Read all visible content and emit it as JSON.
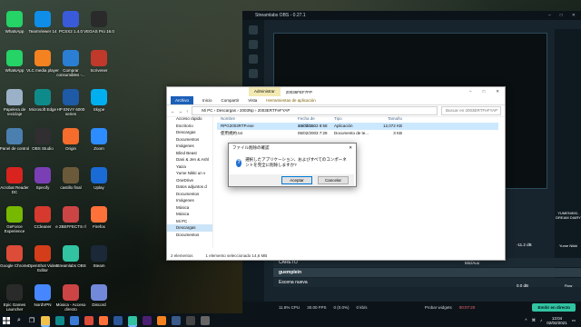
{
  "desktop_icons": [
    {
      "label": "WhatsApp",
      "color": "#25d366",
      "icon": "whatsapp-icon"
    },
    {
      "label": "TeamViewer 14",
      "color": "#0e8ee9",
      "icon": "teamviewer-icon"
    },
    {
      "label": "PCSX2 1.4.0",
      "color": "#3a5bd9",
      "icon": "pcsx2-icon"
    },
    {
      "label": "VEGAS Pro 16.0",
      "color": "#2a2a2a",
      "icon": "vegas-icon"
    },
    {
      "label": "WhatsApp",
      "color": "#25d366",
      "icon": "whatsapp-icon"
    },
    {
      "label": "VLC media player",
      "color": "#f58220",
      "icon": "vlc-icon"
    },
    {
      "label": "Comprar consumibles -...",
      "color": "#2a7fd4",
      "icon": "printer-icon"
    },
    {
      "label": "Scrivener",
      "color": "#c0392b",
      "icon": "scrivener-icon"
    },
    {
      "label": "Papelera de reciclaje",
      "color": "#9bb1c8",
      "icon": "recycle-bin-icon"
    },
    {
      "label": "Microsoft Edge",
      "color": "#0f8a8a",
      "icon": "edge-icon"
    },
    {
      "label": "HP ENVY 6000 series",
      "color": "#1f5aa6",
      "icon": "hp-printer-icon"
    },
    {
      "label": "Skype",
      "color": "#00aff0",
      "icon": "skype-icon"
    },
    {
      "label": "Panel de control",
      "color": "#4a7fb0",
      "icon": "control-panel-icon"
    },
    {
      "label": "OBS Studio",
      "color": "#302e31",
      "icon": "obs-icon"
    },
    {
      "label": "Origin",
      "color": "#f56c2d",
      "icon": "origin-icon"
    },
    {
      "label": "Zoom",
      "color": "#2d8cff",
      "icon": "zoom-icon"
    },
    {
      "label": "Acrobat Reader DC",
      "color": "#d8231f",
      "icon": "acrobat-icon"
    },
    {
      "label": "Specify",
      "color": "#7a3fb5",
      "icon": "speccy-icon"
    },
    {
      "label": "castillo final",
      "color": "#6b5a3a",
      "icon": "image-file-icon"
    },
    {
      "label": "Uplay",
      "color": "#1a6bd6",
      "icon": "uplay-icon"
    },
    {
      "label": "GeForce Experience",
      "color": "#76b900",
      "icon": "geforce-icon"
    },
    {
      "label": "CCleaner",
      "color": "#d63a2e",
      "icon": "ccleaner-icon"
    },
    {
      "label": "e 2BEFFECTS rl",
      "color": "#c44",
      "icon": "pdf-icon"
    },
    {
      "label": "Firefox",
      "color": "#ff7139",
      "icon": "firefox-icon"
    },
    {
      "label": "Google Chrome",
      "color": "#dd4b39",
      "icon": "chrome-icon"
    },
    {
      "label": "OpenShot Video Editor",
      "color": "#d43d1a",
      "icon": "openshot-icon"
    },
    {
      "label": "Streamlabs OBS",
      "color": "#31c3a2",
      "icon": "streamlabs-icon"
    },
    {
      "label": "Steam",
      "color": "#1b2838",
      "icon": "steam-icon"
    },
    {
      "label": "Epic Games Launcher",
      "color": "#2a2a2a",
      "icon": "epic-games-icon"
    },
    {
      "label": "NordVPN",
      "color": "#4687ff",
      "icon": "nordvpn-icon"
    },
    {
      "label": "Música - Acceso directo",
      "color": "#c44",
      "icon": "music-shortcut-icon"
    },
    {
      "label": "Discord",
      "color": "#7289da",
      "icon": "discord-icon"
    }
  ],
  "obs": {
    "title": "Streamlabs OBS - 0.27.1",
    "scenes": [
      "CARETO",
      "guemplein",
      "Escena nueva"
    ],
    "mixer": [
      {
        "label": "-11.2 dB"
      },
      {
        "label": "Mic/Aux"
      },
      {
        "label": "0.0 dB"
      }
    ],
    "status": {
      "cpu": "11.8% CPU",
      "fps": "30.00 FPS",
      "dropped": "0 (0.0%)",
      "bitrate": "0 kb/s"
    },
    "test_widgets": "Probar widgets",
    "timer": "00:07:20",
    "go_live": "Emitir en directo"
  },
  "explorer": {
    "title": "20036FEF7FP",
    "tabs": {
      "file": "Archivo",
      "home": "Inicio",
      "share": "Compartir",
      "view": "Vista",
      "manage": "Herramientas de aplicación",
      "context": "Administrar"
    },
    "breadcrumb": "Mi PC  ›  Descargas  ›  2003Np  ›  2003ERTFeFYAP",
    "search_placeholder": "Buscar en 2003ERTFeFYAP",
    "nav": [
      {
        "label": "Acceso rápido",
        "selected": false
      },
      {
        "label": "Escritorio",
        "selected": false
      },
      {
        "label": "Descargas",
        "selected": false
      },
      {
        "label": "Documentos",
        "selected": false
      },
      {
        "label": "Imágenes",
        "selected": false
      },
      {
        "label": "Blind Beast",
        "selected": false
      },
      {
        "label": "Dani & Jen & Ashl",
        "selected": false
      },
      {
        "label": "Yaiza",
        "selected": false
      },
      {
        "label": "Yume Nikki un v",
        "selected": false
      },
      {
        "label": "OneDrive",
        "selected": false
      },
      {
        "label": "Datos adjuntos d",
        "selected": false
      },
      {
        "label": "Documentos",
        "selected": false
      },
      {
        "label": "Imágenes",
        "selected": false
      },
      {
        "label": "Música",
        "selected": false
      },
      {
        "label": "Música",
        "selected": false
      },
      {
        "label": "Mi PC",
        "selected": false
      },
      {
        "label": "Descargas",
        "selected": true
      },
      {
        "label": "Documentos",
        "selected": false
      }
    ],
    "columns": {
      "name": "Nombre",
      "date": "Fecha de modifica...",
      "type": "Tipo",
      "size": "Tamaño"
    },
    "files": [
      {
        "name": "RPG2003RTP.exe",
        "date": "10/02/2003 8:58",
        "type": "Aplicación",
        "size": "12,072 KB",
        "selected": true
      },
      {
        "name": "使用規約.txt",
        "date": "06/02/2003 7:28",
        "type": "Documento de te...",
        "size": "3 KB",
        "selected": false
      }
    ],
    "status_count": "2 elementos",
    "status_selection": "1 elemento seleccionado  14,6 MB"
  },
  "dialog": {
    "title": "ファイル削除の確認",
    "message": "選択したアプリケーション、およびすべてのコンポーネントを完全に削除しますか?",
    "ok": "Aceptar",
    "cancel": "Cancelar"
  },
  "taskbar": {
    "time": "13:04",
    "date": "02/02/2021",
    "apps": [
      {
        "icon": "file-explorer-icon",
        "color": "#f2c24b",
        "active": true
      },
      {
        "icon": "edge-icon",
        "color": "#0f8a8a",
        "active": false
      },
      {
        "icon": "store-icon",
        "color": "#3a7bd5",
        "active": false
      },
      {
        "icon": "chrome-icon",
        "color": "#dd4b39",
        "active": false
      },
      {
        "icon": "firefox-icon",
        "color": "#ff7139",
        "active": false
      },
      {
        "icon": "word-icon",
        "color": "#2b579a",
        "active": false
      },
      {
        "icon": "streamlabs-icon",
        "color": "#31c3a2",
        "active": true
      },
      {
        "icon": "premiere-icon",
        "color": "#4b1f72",
        "active": false
      },
      {
        "icon": "vlc-icon",
        "color": "#f58220",
        "active": false
      },
      {
        "icon": "steam-icon",
        "color": "#3a5a8a",
        "active": false
      },
      {
        "icon": "obs-icon",
        "color": "#444",
        "active": false
      },
      {
        "icon": "settings-icon",
        "color": "#666",
        "active": false
      }
    ]
  },
  "right_desktop": {
    "labels": [
      "YUMENIKKI-DREAM DIARY",
      "Yume Nikki",
      "Flow"
    ]
  }
}
